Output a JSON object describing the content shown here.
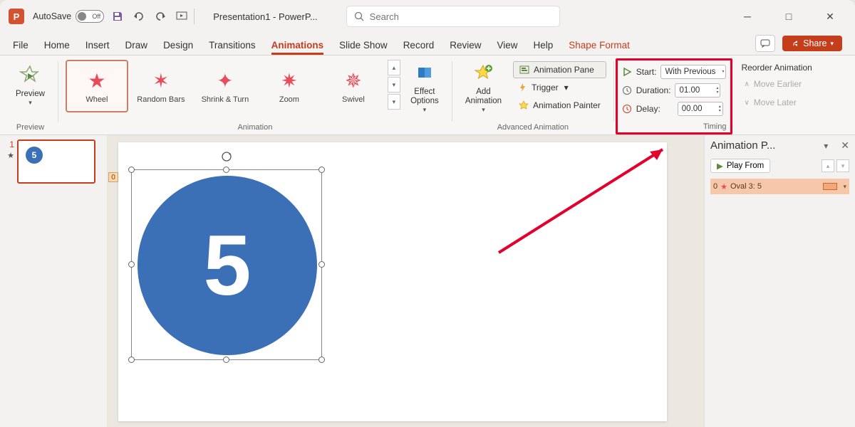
{
  "titlebar": {
    "autosave_label": "AutoSave",
    "autosave_state": "Off",
    "doc_title": "Presentation1 - PowerP...",
    "search_placeholder": "Search"
  },
  "tabs": {
    "items": [
      "File",
      "Home",
      "Insert",
      "Draw",
      "Design",
      "Transitions",
      "Animations",
      "Slide Show",
      "Record",
      "Review",
      "View",
      "Help",
      "Shape Format"
    ],
    "active_index": 6,
    "share_label": "Share"
  },
  "ribbon": {
    "preview": {
      "label": "Preview",
      "group": "Preview"
    },
    "animations": [
      {
        "name": "Wheel"
      },
      {
        "name": "Random Bars"
      },
      {
        "name": "Shrink & Turn"
      },
      {
        "name": "Zoom"
      },
      {
        "name": "Swivel"
      }
    ],
    "animations_group": "Animation",
    "effect_options": "Effect\nOptions",
    "add_animation": "Add\nAnimation",
    "animation_pane": "Animation Pane",
    "trigger": "Trigger",
    "animation_painter": "Animation Painter",
    "advanced_group": "Advanced Animation",
    "timing": {
      "start_label": "Start:",
      "start_value": "With Previous",
      "duration_label": "Duration:",
      "duration_value": "01.00",
      "delay_label": "Delay:",
      "delay_value": "00.00",
      "group": "Timing"
    },
    "reorder": {
      "title": "Reorder Animation",
      "earlier": "Move Earlier",
      "later": "Move Later"
    }
  },
  "thumbs": {
    "slide_num": "1",
    "circle_text": "5"
  },
  "canvas": {
    "anim_tag": "0",
    "circle_text": "5"
  },
  "anim_pane": {
    "title": "Animation P...",
    "play": "Play From",
    "entry_index": "0",
    "entry_name": "Oval 3: 5"
  }
}
